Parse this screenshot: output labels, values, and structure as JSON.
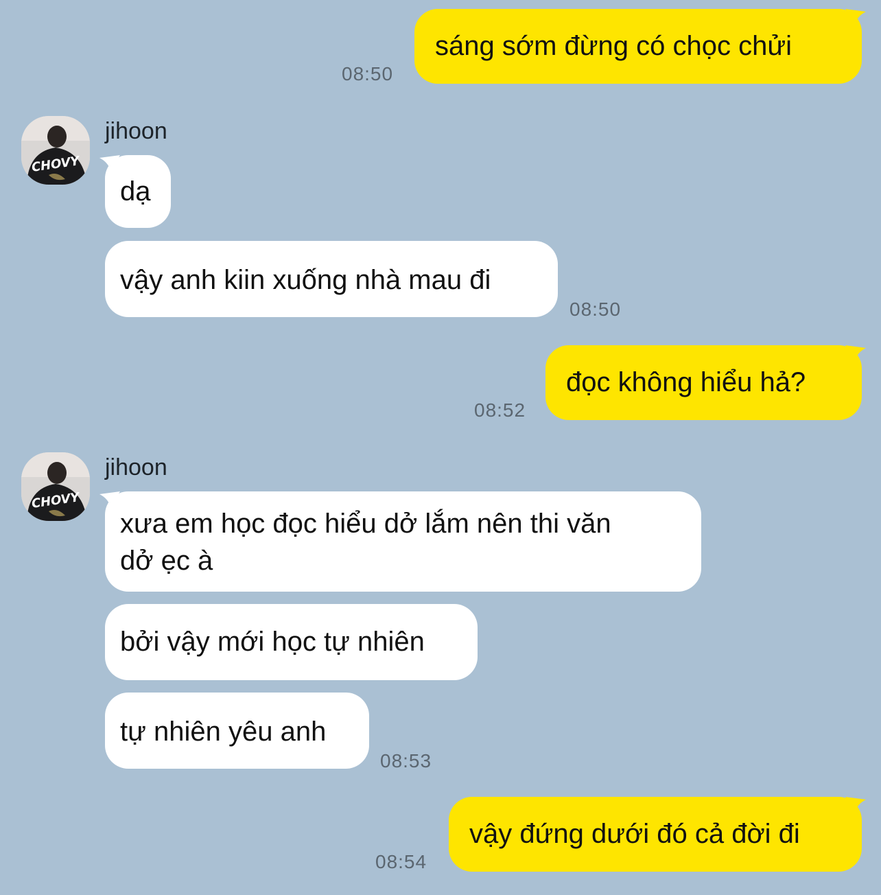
{
  "chat": {
    "messages": [
      {
        "dir": "out",
        "text": "sáng sớm đừng có chọc chửi",
        "time": "08:50"
      },
      {
        "dir": "in",
        "sender": "jihoon",
        "text": "dạ"
      },
      {
        "dir": "in",
        "text": "vậy anh kiin xuống nhà mau đi",
        "time": "08:50"
      },
      {
        "dir": "out",
        "text": "đọc không hiểu hả?",
        "time": "08:52"
      },
      {
        "dir": "in",
        "sender": "jihoon",
        "text_line1": "xưa em học đọc hiểu dở lắm nên thi văn",
        "text_line2": "dở ẹc à"
      },
      {
        "dir": "in",
        "text": "bởi vậy mới học tự nhiên"
      },
      {
        "dir": "in",
        "text": "tự nhiên yêu anh",
        "time": "08:53"
      },
      {
        "dir": "out",
        "text": "vậy đứng dưới đó cả đời đi",
        "time": "08:54"
      }
    ],
    "avatar_text": "CHOVY",
    "colors": {
      "background": "#aac0d3",
      "outgoing_bubble": "#fee500",
      "incoming_bubble": "#ffffff",
      "timestamp": "#5b6670"
    },
    "icons": {
      "avatar": "profile-photo-avatar"
    }
  }
}
